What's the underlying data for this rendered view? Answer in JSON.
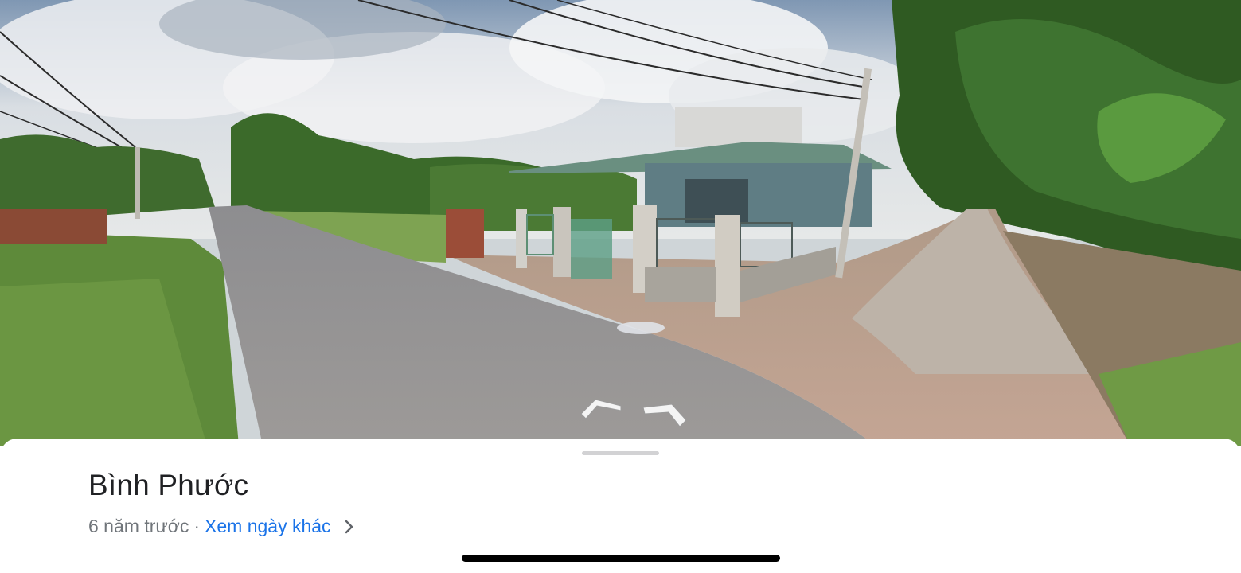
{
  "street_view": {
    "scene_icon": "street-view-panorama",
    "nav_arrows": [
      "arrow-left-forward-icon",
      "arrow-right-forward-icon"
    ]
  },
  "sheet": {
    "title": "Bình Phước",
    "age": "6 năm trước",
    "separator": "·",
    "other_dates_link": "Xem ngày khác",
    "chevron_icon": "chevron-right-icon"
  },
  "colors": {
    "title": "#202124",
    "meta": "#70757a",
    "link": "#1a73e8",
    "home_indicator": "#000000"
  }
}
